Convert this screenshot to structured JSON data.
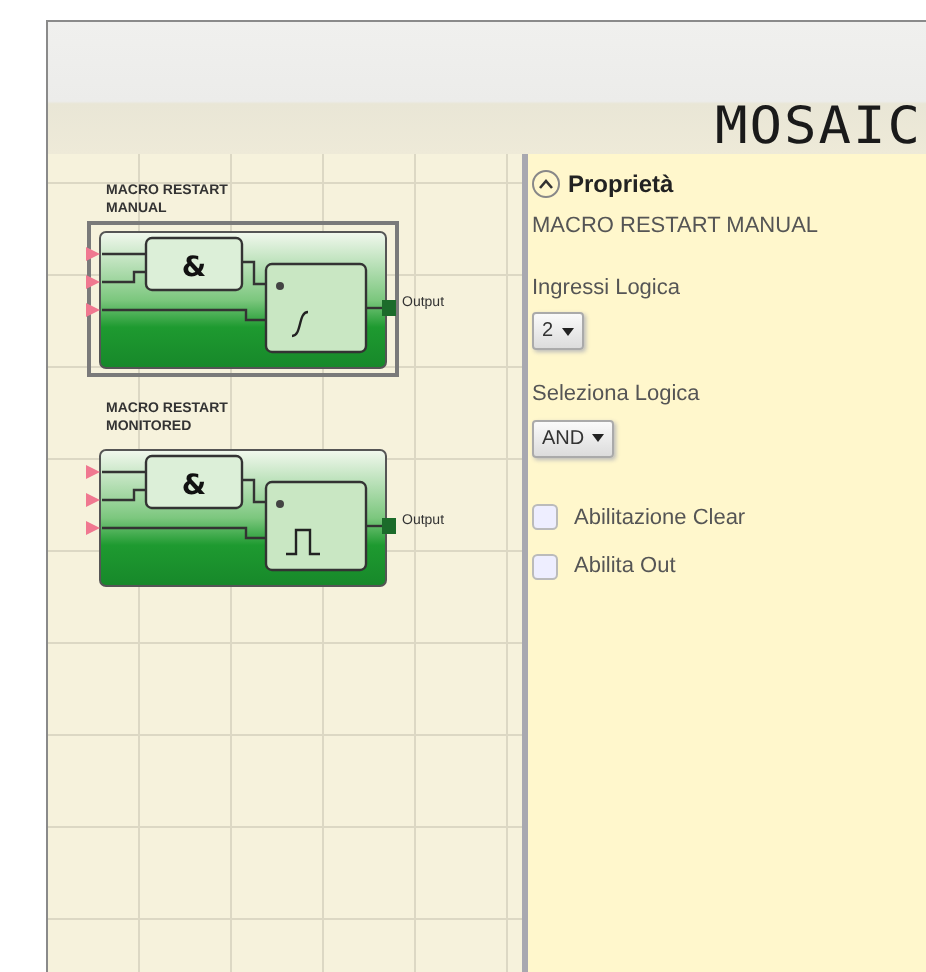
{
  "header": {
    "logo": "MOSAIC"
  },
  "canvas": {
    "blocks": [
      {
        "title": "MACRO RESTART MANUAL",
        "selected": true,
        "kind": "manual",
        "gate": "&",
        "output": "Output"
      },
      {
        "title": "MACRO RESTART MONITORED",
        "selected": false,
        "kind": "monitored",
        "gate": "&",
        "output": "Output"
      }
    ]
  },
  "properties": {
    "title": "Proprietà",
    "expanded": true,
    "block_name": "MACRO RESTART MANUAL",
    "fields": [
      {
        "kind": "select",
        "label": "Ingressi Logica",
        "value": "2"
      },
      {
        "kind": "select",
        "label": "Seleziona Logica",
        "value": "AND"
      },
      {
        "kind": "checkbox",
        "label": "Abilitazione Clear",
        "checked": false
      },
      {
        "kind": "checkbox",
        "label": "Abilita Out",
        "checked": false
      }
    ]
  }
}
